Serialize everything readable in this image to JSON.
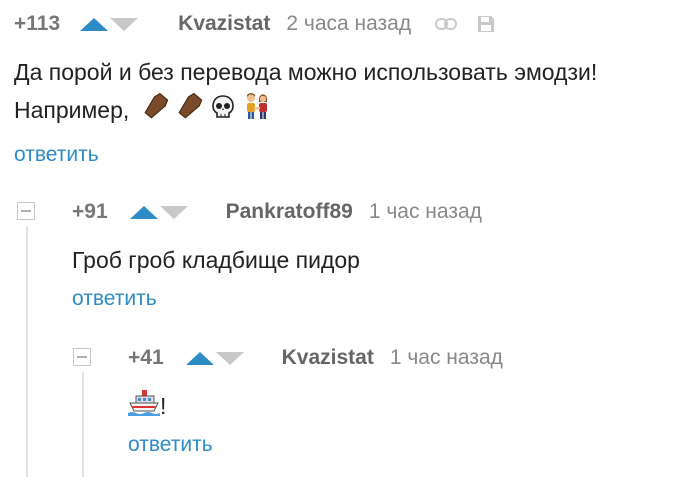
{
  "comments": [
    {
      "rating": "+113",
      "author": "Kvazistat",
      "time": "2 часа назад",
      "text_line1": "Да порой и без перевода можно использовать эмодзи!",
      "text_line2": "Например,",
      "emojis": [
        "coffin-icon",
        "coffin-icon",
        "skull-icon",
        "couple-holding-hands-icon"
      ],
      "reply": "ответить"
    },
    {
      "rating": "+91",
      "author": "Pankratoff89",
      "time": "1 час назад",
      "text": "Гроб гроб кладбище пидор",
      "reply": "ответить"
    },
    {
      "rating": "+41",
      "author": "Kvazistat",
      "time": "1 час назад",
      "emojis": [
        "ship-icon"
      ],
      "text_suffix": "!",
      "reply": "ответить"
    }
  ],
  "colors": {
    "accent": "#2d8cc6",
    "muted": "#c8c8c8",
    "author": "#666666"
  }
}
